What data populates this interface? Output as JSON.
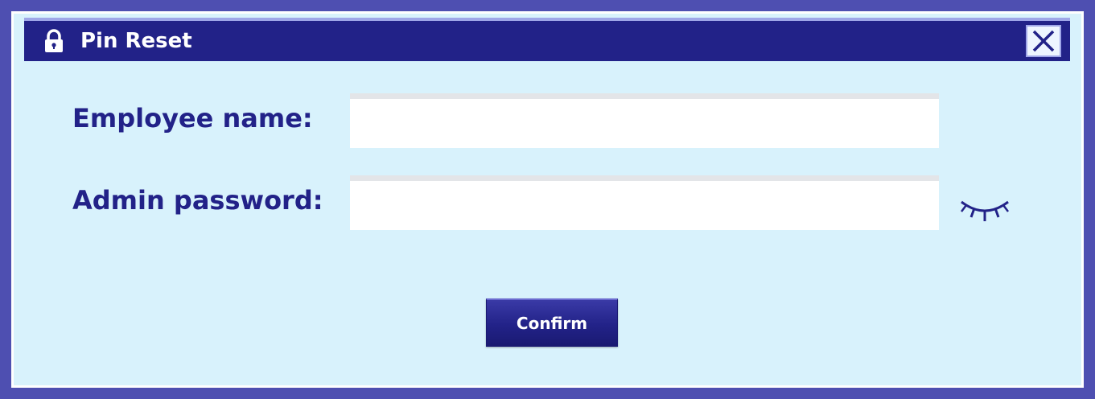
{
  "dialog": {
    "title": "Pin Reset",
    "title_icon": "lock-icon",
    "close_icon": "close-icon"
  },
  "form": {
    "employee_label": "Employee name:",
    "employee_value": "",
    "admin_label": "Admin password:",
    "admin_value": "",
    "password_toggle_icon": "eye-closed-icon"
  },
  "actions": {
    "confirm_label": "Confirm"
  },
  "colors": {
    "frame": "#4e4fb1",
    "dialog_background": "#d8f2fc",
    "titlebar": "#222288",
    "text_accent": "#222288",
    "button": "#222288"
  }
}
